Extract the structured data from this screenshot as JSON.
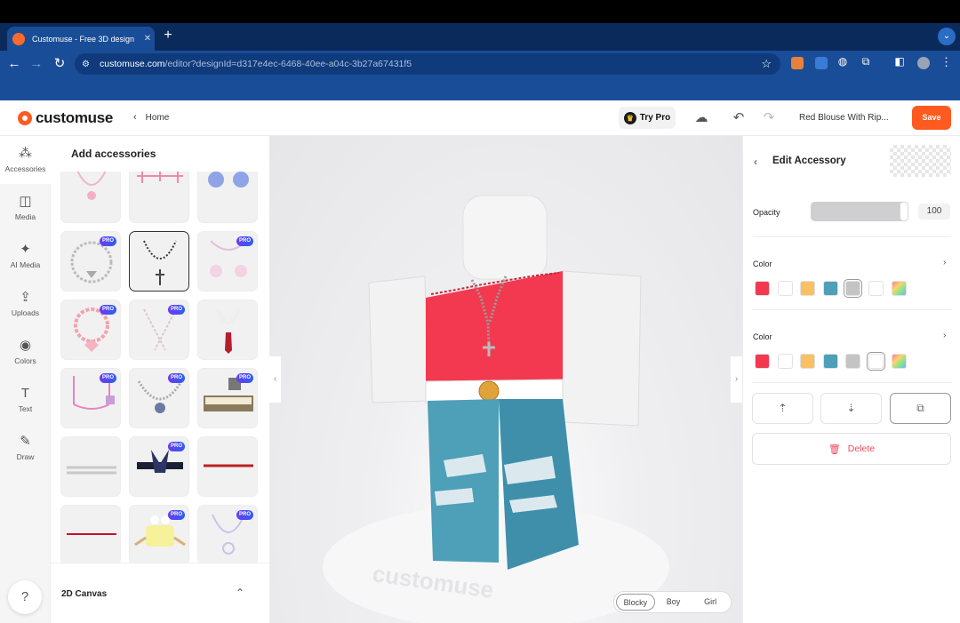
{
  "browser": {
    "tab_title": "Customuse - Free 3D design",
    "tab_close": "✕",
    "new_tab": "+",
    "tab_menu": "⌄",
    "url_host": "customuse.com",
    "url_path": "/editor?designId=d317e4ec-6468-40ee-a04c-3b27a67431f5",
    "back_glyph": "←",
    "forward_glyph": "→",
    "reload_glyph": "↻",
    "star_glyph": "☆",
    "menu_glyph": "⋮"
  },
  "header": {
    "logo": "customuse",
    "home_label": "Home",
    "home_chev": "‹",
    "try_pro": "Try Pro",
    "design_name": "Red Blouse With Rip...",
    "save": "Save",
    "cloud_glyph": "☁",
    "undo_glyph": "↶",
    "redo_glyph": "↷"
  },
  "rail": {
    "items": [
      {
        "label": "Accessories",
        "glyph": "⁂",
        "icon": "accessories-icon"
      },
      {
        "label": "Media",
        "glyph": "◫",
        "icon": "media-icon"
      },
      {
        "label": "AI Media",
        "glyph": "✦",
        "icon": "ai-media-icon"
      },
      {
        "label": "Uploads",
        "glyph": "⇪",
        "icon": "uploads-icon"
      },
      {
        "label": "Colors",
        "glyph": "◉",
        "icon": "colors-icon"
      },
      {
        "label": "Text",
        "glyph": "T",
        "icon": "text-icon"
      },
      {
        "label": "Draw",
        "glyph": "✎",
        "icon": "draw-icon"
      }
    ],
    "help": "?"
  },
  "accessories": {
    "title": "Add accessories",
    "tiles": [
      {
        "name": "heart-necklace-pink",
        "pro": false
      },
      {
        "name": "pink-crop-straps",
        "pro": false
      },
      {
        "name": "blue-bows",
        "pro": false
      },
      {
        "name": "silver-chain-heart",
        "pro": true
      },
      {
        "name": "rosary-cross",
        "pro": false,
        "selected": true
      },
      {
        "name": "pink-bows-straps",
        "pro": true
      },
      {
        "name": "pink-ruffle-bow",
        "pro": true
      },
      {
        "name": "pink-bow-chains",
        "pro": true
      },
      {
        "name": "red-tie",
        "pro": false
      },
      {
        "name": "pink-straps-bag",
        "pro": true
      },
      {
        "name": "chain-orb-pendant",
        "pro": true
      },
      {
        "name": "striped-collar",
        "pro": true
      },
      {
        "name": "grey-lace-band",
        "pro": false
      },
      {
        "name": "navy-bow-band",
        "pro": true
      },
      {
        "name": "red-thin-belt",
        "pro": false
      },
      {
        "name": "red-thin-band",
        "pro": false
      },
      {
        "name": "bunny-bag",
        "pro": true
      },
      {
        "name": "lavender-necklace",
        "pro": true
      }
    ],
    "pro_label": "PRO",
    "canvas_label": "2D Canvas",
    "canvas_chev": "⌃"
  },
  "viewport": {
    "watermark": "customuse",
    "toggle": [
      "Blocky",
      "Boy",
      "Girl"
    ],
    "toggle_active": "Blocky",
    "left_tab": "‹",
    "right_tab": "›"
  },
  "edit": {
    "back": "‹",
    "title": "Edit Accessory",
    "opacity_label": "Opacity",
    "opacity_value": "100",
    "opacity_fraction": 1.0,
    "color_label_1": "Color",
    "color_label_2": "Color",
    "chev": "›",
    "swatches_1": [
      "#f2394f",
      "#ffffff",
      "#f9c064",
      "#4e9fb8",
      "#c4c4c4",
      "#ffffff",
      "rainbow"
    ],
    "swatches_1_selected": 4,
    "swatches_2": [
      "#f2394f",
      "#ffffff",
      "#f9c064",
      "#4e9fb8",
      "#c4c4c4",
      "#ffffff",
      "rainbow"
    ],
    "swatches_2_selected": 5,
    "layer_buttons": [
      {
        "glyph": "⇡",
        "name": "bring-forward-button"
      },
      {
        "glyph": "⇣",
        "name": "send-backward-button"
      },
      {
        "glyph": "⧉",
        "name": "duplicate-button"
      }
    ],
    "delete": "Delete",
    "trash_glyph": "🗑"
  },
  "colors": {
    "brand": "#ff5a1f",
    "chrome_dark": "#0b2a5c",
    "chrome": "#1a4d97",
    "shirt": "#f2394f",
    "jeans": "#4e9fb8"
  }
}
